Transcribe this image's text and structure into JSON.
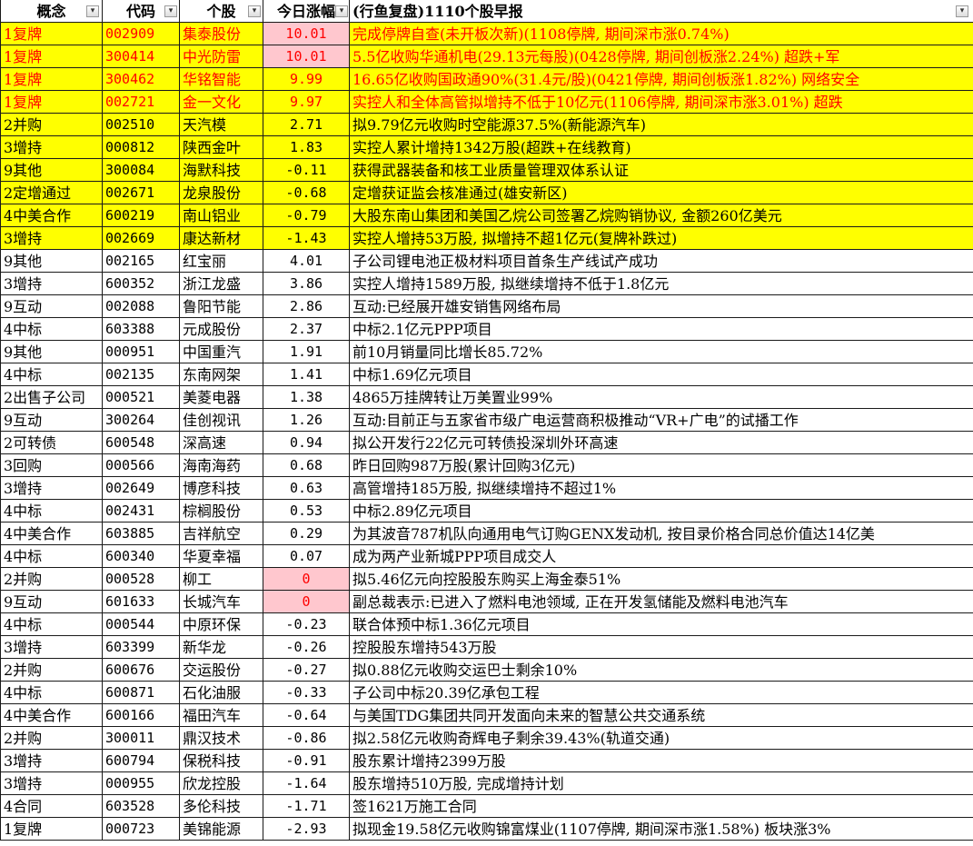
{
  "header": {
    "concept": "概念",
    "code": "代码",
    "stock": "个股",
    "change": "今日涨幅",
    "news": "(行鱼复盘)1110个股早报"
  },
  "rows": [
    {
      "concept": "1复牌",
      "code": "002909",
      "stock": "集泰股份",
      "change": "10.01",
      "news": "完成停牌自查(未开板次新)(1108停牌, 期间深市涨0.74%)",
      "style": "yellow-red-pink"
    },
    {
      "concept": "1复牌",
      "code": "300414",
      "stock": "中光防雷",
      "change": "10.01",
      "news": "5.5亿收购华通机电(29.13元每股)(0428停牌, 期间创板涨2.24%) 超跌+军",
      "style": "yellow-red-pink"
    },
    {
      "concept": "1复牌",
      "code": "300462",
      "stock": "华铭智能",
      "change": "9.99",
      "news": "16.65亿收购国政通90%(31.4元/股)(0421停牌, 期间创板涨1.82%) 网络安全",
      "style": "yellow-red"
    },
    {
      "concept": "1复牌",
      "code": "002721",
      "stock": "金一文化",
      "change": "9.97",
      "news": "实控人和全体高管拟增持不低于10亿元(1106停牌, 期间深市涨3.01%) 超跌",
      "style": "yellow-red"
    },
    {
      "concept": "2并购",
      "code": "002510",
      "stock": "天汽模",
      "change": "2.71",
      "news": "拟9.79亿元收购时空能源37.5%(新能源汽车)",
      "style": "yellow"
    },
    {
      "concept": "3增持",
      "code": "000812",
      "stock": "陕西金叶",
      "change": "1.83",
      "news": "实控人累计增持1342万股(超跌+在线教育)",
      "style": "yellow"
    },
    {
      "concept": "9其他",
      "code": "300084",
      "stock": "海默科技",
      "change": "-0.11",
      "news": "获得武器装备和核工业质量管理双体系认证",
      "style": "yellow"
    },
    {
      "concept": "2定增通过",
      "code": "002671",
      "stock": "龙泉股份",
      "change": "-0.68",
      "news": "定增获证监会核准通过(雄安新区)",
      "style": "yellow"
    },
    {
      "concept": "4中美合作",
      "code": "600219",
      "stock": "南山铝业",
      "change": "-0.79",
      "news": "大股东南山集团和美国乙烷公司签署乙烷购销协议, 金额260亿美元",
      "style": "yellow"
    },
    {
      "concept": "3增持",
      "code": "002669",
      "stock": "康达新材",
      "change": "-1.43",
      "news": "实控人增持53万股, 拟增持不超1亿元(复牌补跌过)",
      "style": "yellow"
    },
    {
      "concept": "9其他",
      "code": "002165",
      "stock": "红宝丽",
      "change": "4.01",
      "news": "子公司锂电池正极材料项目首条生产线试产成功",
      "style": "plain"
    },
    {
      "concept": "3增持",
      "code": "600352",
      "stock": "浙江龙盛",
      "change": "3.86",
      "news": "实控人增持1589万股, 拟继续增持不低于1.8亿元",
      "style": "plain"
    },
    {
      "concept": "9互动",
      "code": "002088",
      "stock": "鲁阳节能",
      "change": "2.86",
      "news": "互动:已经展开雄安销售网络布局",
      "style": "plain"
    },
    {
      "concept": "4中标",
      "code": "603388",
      "stock": "元成股份",
      "change": "2.37",
      "news": "中标2.1亿元PPP项目",
      "style": "plain"
    },
    {
      "concept": "9其他",
      "code": "000951",
      "stock": "中国重汽",
      "change": "1.91",
      "news": "前10月销量同比增长85.72%",
      "style": "plain"
    },
    {
      "concept": "4中标",
      "code": "002135",
      "stock": "东南网架",
      "change": "1.41",
      "news": "中标1.69亿元项目",
      "style": "plain"
    },
    {
      "concept": "2出售子公司",
      "code": "000521",
      "stock": "美菱电器",
      "change": "1.38",
      "news": "4865万挂牌转让万美置业99%",
      "style": "plain"
    },
    {
      "concept": "9互动",
      "code": "300264",
      "stock": "佳创视讯",
      "change": "1.26",
      "news": "互动:目前正与五家省市级广电运营商积极推动“VR+广电”的试播工作",
      "style": "plain"
    },
    {
      "concept": "2可转债",
      "code": "600548",
      "stock": "深高速",
      "change": "0.94",
      "news": "拟公开发行22亿元可转债投深圳外环高速",
      "style": "plain"
    },
    {
      "concept": "3回购",
      "code": "000566",
      "stock": "海南海药",
      "change": "0.68",
      "news": "昨日回购987万股(累计回购3亿元)",
      "style": "plain"
    },
    {
      "concept": "3增持",
      "code": "002649",
      "stock": "博彦科技",
      "change": "0.63",
      "news": "高管增持185万股, 拟继续增持不超过1%",
      "style": "plain"
    },
    {
      "concept": "4中标",
      "code": "002431",
      "stock": "棕榈股份",
      "change": "0.53",
      "news": "中标2.89亿元项目",
      "style": "plain"
    },
    {
      "concept": "4中美合作",
      "code": "603885",
      "stock": "吉祥航空",
      "change": "0.29",
      "news": "为其波音787机队向通用电气订购GENX发动机, 按目录价格合同总价值达14亿美",
      "style": "plain"
    },
    {
      "concept": "4中标",
      "code": "600340",
      "stock": "华夏幸福",
      "change": "0.07",
      "news": "成为两产业新城PPP项目成交人",
      "style": "plain"
    },
    {
      "concept": "2并购",
      "code": "000528",
      "stock": "柳工",
      "change": "0",
      "news": "拟5.46亿元向控股股东购买上海金泰51%",
      "style": "pink"
    },
    {
      "concept": "9互动",
      "code": "601633",
      "stock": "长城汽车",
      "change": "0",
      "news": "副总裁表示:已进入了燃料电池领域, 正在开发氢储能及燃料电池汽车",
      "style": "pink"
    },
    {
      "concept": "4中标",
      "code": "000544",
      "stock": "中原环保",
      "change": "-0.23",
      "news": "联合体预中标1.36亿元项目",
      "style": "plain"
    },
    {
      "concept": "3增持",
      "code": "603399",
      "stock": "新华龙",
      "change": "-0.26",
      "news": "控股股东增持543万股",
      "style": "plain"
    },
    {
      "concept": "2并购",
      "code": "600676",
      "stock": "交运股份",
      "change": "-0.27",
      "news": "拟0.88亿元收购交运巴士剩余10%",
      "style": "plain"
    },
    {
      "concept": "4中标",
      "code": "600871",
      "stock": "石化油服",
      "change": "-0.33",
      "news": "子公司中标20.39亿承包工程",
      "style": "plain"
    },
    {
      "concept": "4中美合作",
      "code": "600166",
      "stock": "福田汽车",
      "change": "-0.64",
      "news": "与美国TDG集团共同开发面向未来的智慧公共交通系统",
      "style": "plain"
    },
    {
      "concept": "2并购",
      "code": "300011",
      "stock": "鼎汉技术",
      "change": "-0.86",
      "news": "拟2.58亿元收购奇辉电子剩余39.43%(轨道交通)",
      "style": "plain"
    },
    {
      "concept": "3增持",
      "code": "600794",
      "stock": "保税科技",
      "change": "-0.91",
      "news": "股东累计增持2399万股",
      "style": "plain"
    },
    {
      "concept": "3增持",
      "code": "000955",
      "stock": "欣龙控股",
      "change": "-1.64",
      "news": "股东增持510万股, 完成增持计划",
      "style": "plain"
    },
    {
      "concept": "4合同",
      "code": "603528",
      "stock": "多伦科技",
      "change": "-1.71",
      "news": "签1621万施工合同",
      "style": "plain"
    },
    {
      "concept": "1复牌",
      "code": "000723",
      "stock": "美锦能源",
      "change": "-2.93",
      "news": "拟现金19.58亿元收购锦富煤业(1107停牌, 期间深市涨1.58%) 板块涨3%",
      "style": "plain"
    }
  ]
}
